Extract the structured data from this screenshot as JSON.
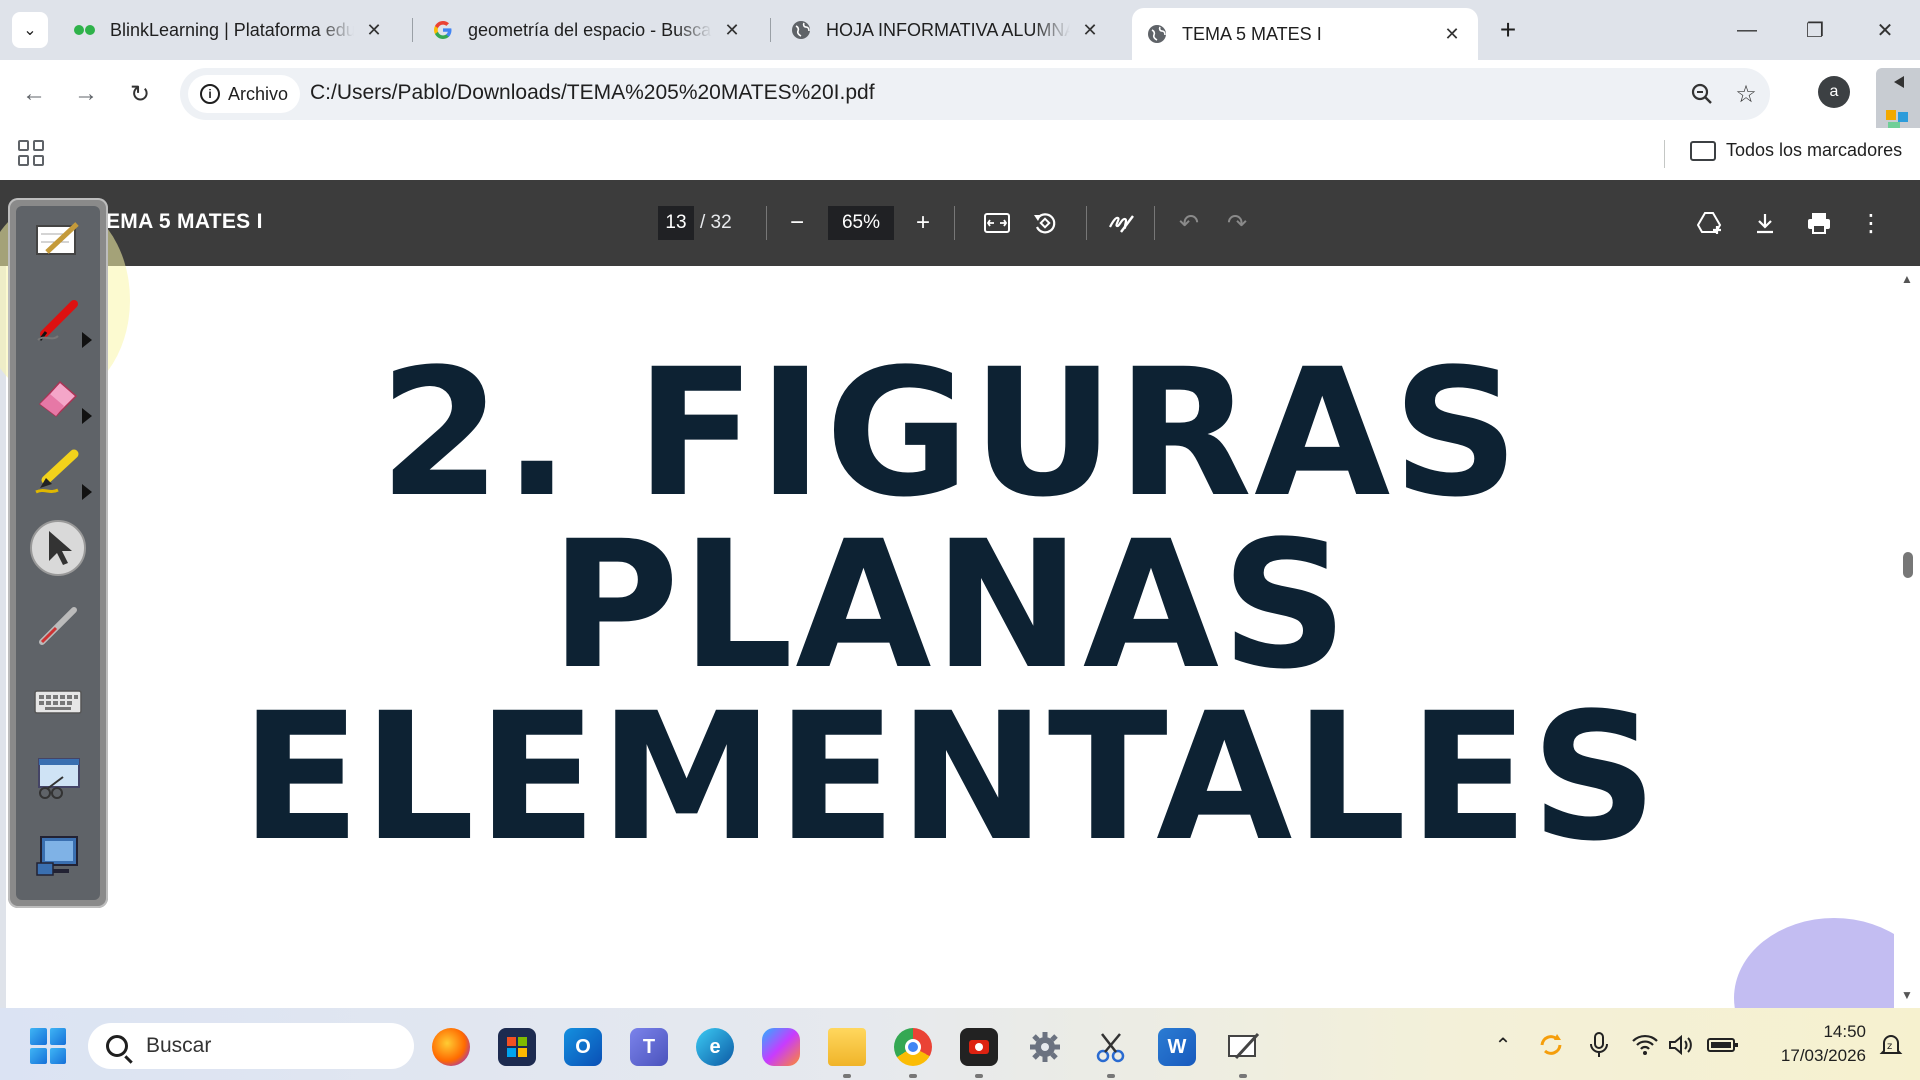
{
  "tabs": [
    {
      "title": "BlinkLearning | Plataforma educ",
      "active": false
    },
    {
      "title": "geometría del espacio - Buscar",
      "active": false
    },
    {
      "title": "HOJA INFORMATIVA ALUMNAD",
      "active": false
    },
    {
      "title": "TEMA 5 MATES I",
      "active": true
    }
  ],
  "address": {
    "chip_label": "Archivo",
    "url": "C:/Users/Pablo/Downloads/TEMA%205%20MATES%20I.pdf"
  },
  "profile_initial": "a",
  "bookmarks": {
    "all_label": "Todos los marcadores"
  },
  "pdf": {
    "title": "EMA 5 MATES I",
    "page_current": "13",
    "page_total": "/ 32",
    "zoom": "65%",
    "content": {
      "line1": "2. FIGURAS",
      "line2": "PLANAS",
      "line3": "ELEMENTALES"
    }
  },
  "taskbar": {
    "search_placeholder": "Buscar",
    "time": "14:50",
    "date": "17/03/2026"
  }
}
